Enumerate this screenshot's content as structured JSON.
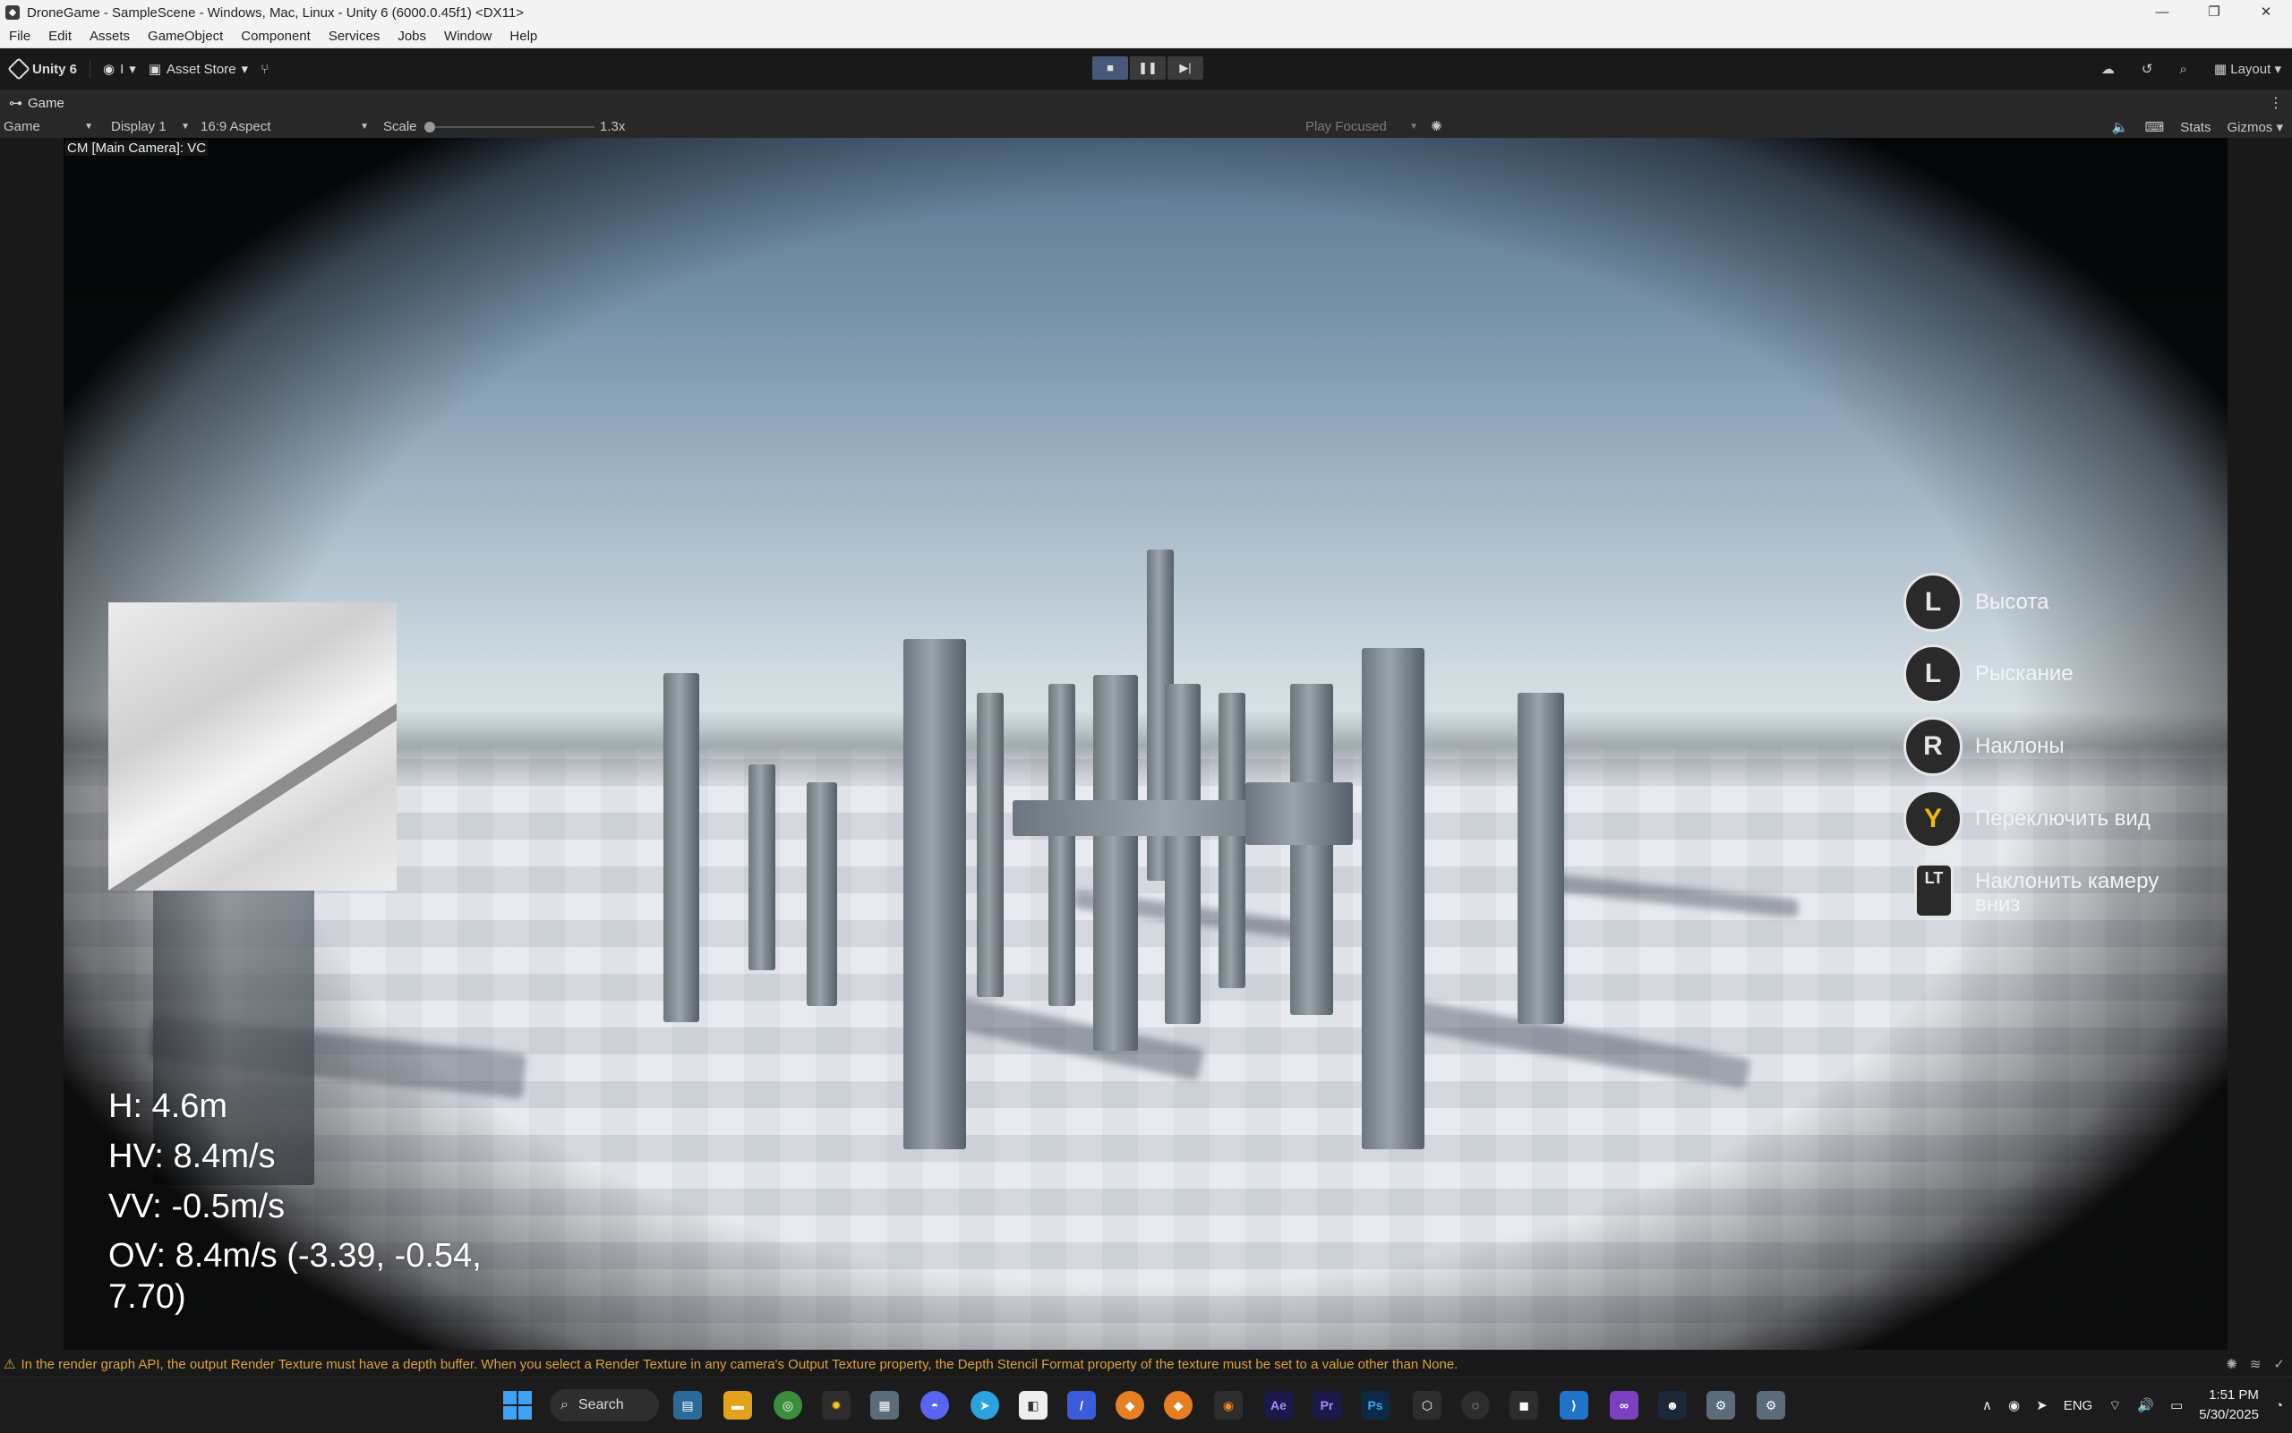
{
  "window": {
    "title": "DroneGame - SampleScene - Windows, Mac, Linux - Unity 6 (6000.0.45f1) <DX11>",
    "controls": [
      "—",
      "❐",
      "✕"
    ]
  },
  "menu": [
    "File",
    "Edit",
    "Assets",
    "GameObject",
    "Component",
    "Services",
    "Jobs",
    "Window",
    "Help"
  ],
  "toolbar": {
    "unity_label": "Unity 6",
    "account_label": "I",
    "asset_store_label": "Asset Store",
    "layout_label": "Layout"
  },
  "game_tab": {
    "label": "Game"
  },
  "game_toolbar": {
    "mode": "Game",
    "display": "Display 1",
    "aspect": "16:9 Aspect",
    "scale_label": "Scale",
    "scale_value": "1.3x",
    "play_focused": "Play Focused",
    "stats": "Stats",
    "gizmos": "Gizmos"
  },
  "viewport": {
    "camera_label": "CM [Main Camera]: VC"
  },
  "telemetry": {
    "h": "H: 4.6m",
    "hv": "HV: 8.4m/s",
    "vv": "VV: -0.5m/s",
    "ov": "OV: 8.4m/s (-3.39, -0.54, 7.70)"
  },
  "controls": [
    {
      "button": "L",
      "label": "Высота"
    },
    {
      "button": "L",
      "label": "Рыскание"
    },
    {
      "button": "R",
      "label": "Наклоны"
    },
    {
      "button": "Y",
      "label": "Переключить вид"
    },
    {
      "button": "LT",
      "label": "Наклонить камеру вниз"
    }
  ],
  "console": {
    "message": "In the render graph API, the output Render Texture must have a depth buffer. When you select a Render Texture in any camera's Output Texture property, the Depth Stencil Format property of the texture must be set to a value other than None."
  },
  "taskbar": {
    "search_label": "Search",
    "language": "ENG",
    "time": "1:51 PM",
    "date": "5/30/2025",
    "apps": [
      "file-explorer",
      "chrome",
      "discord",
      "telegram",
      "ae",
      "pr",
      "ps",
      "vscode",
      "visual-studio",
      "steam",
      "settings"
    ]
  },
  "colors": {
    "warning": "#d9a33c",
    "accent": "#3da2f5",
    "play_active": "#465a78"
  }
}
